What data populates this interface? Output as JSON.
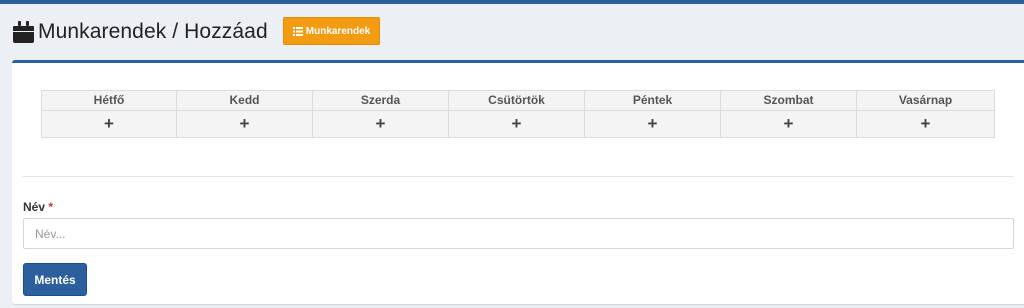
{
  "header": {
    "title": "Munkarendek / Hozzáad",
    "title_icon": "calendar-icon",
    "back_button_label": "Munkarendek",
    "back_button_icon": "list-icon"
  },
  "schedule": {
    "days": [
      {
        "label": "Hétfő",
        "add_symbol": "+"
      },
      {
        "label": "Kedd",
        "add_symbol": "+"
      },
      {
        "label": "Szerda",
        "add_symbol": "+"
      },
      {
        "label": "Csütörtök",
        "add_symbol": "+"
      },
      {
        "label": "Péntek",
        "add_symbol": "+"
      },
      {
        "label": "Szombat",
        "add_symbol": "+"
      },
      {
        "label": "Vasárnap",
        "add_symbol": "+"
      }
    ]
  },
  "form": {
    "name_label": "Név",
    "required_marker": "*",
    "name_placeholder": "Név...",
    "name_value": "",
    "save_label": "Mentés"
  },
  "colors": {
    "primary": "#2c5f9e",
    "warning": "#f39c12",
    "required": "#c0392b"
  }
}
